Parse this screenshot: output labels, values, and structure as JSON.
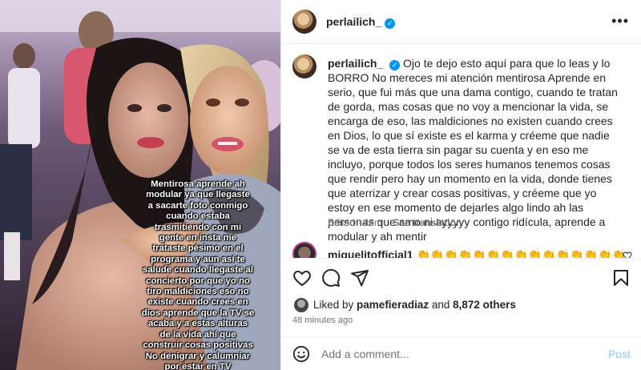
{
  "post": {
    "author": "perlailich_",
    "verified_icon": "verified-check-icon",
    "more_icon": "ellipsis-icon",
    "overlay_text": "Mentirosa aprende ah\nmodular ya que llegaste\na sacarte foto conmigo\ncuando estaba\ntrasmitiendo con mi\ngente en insta me\ntrataste pésimo en el\nprograma  y aun así te\nsalude cuando llegaste al\nconcierto por que yo no\ntiro maldiciones eso no\nexiste cuando crees en\ndios aprende que la TV se\nacaba y a estas alturas\nde la vida ahí que\nconstruir cosas positivas\nNo denigrar y calumniar\npor estar en TV"
  },
  "caption": {
    "username": "perlailich_",
    "text": "Ojo te dejo esto aquí para que lo leas y lo BORRO No mereces mi atención mentirosa Aprende en serio, que fui más que una dama contigo, cuando te tratan de gorda, mas cosas que no voy a mencionar la vida, se encarga de eso, las maldiciones no existen cuando crees en Dios, lo que sí existe es el karma y créeme que nadie se va de esta tierra sin pagar su cuenta y en eso me incluyo, porque todos los seres humanos tenemos cosas que rendir pero hay un momento en la vida, donde tienes que aterrizar y crear cosas positivas, y créeme que yo estoy en ese momento de dejarles algo lindo ah las personas que amo ni ayyyyy contigo ridícula, aprende a modular y ah mentir",
    "edited": "Edited · 46m",
    "see_translation": "See translation"
  },
  "comments": [
    {
      "username": "miguelitofficial1",
      "text": "👏👏👏👏👏👏👏👏👏👏👏👏👏👏👏",
      "like_icon": "heart-outline-icon"
    }
  ],
  "actions": {
    "like_icon": "heart-outline-icon",
    "comment_icon": "speech-bubble-icon",
    "share_icon": "paper-plane-icon",
    "save_icon": "bookmark-icon"
  },
  "likes": {
    "prefix": "Liked by ",
    "user": "pamefieradiaz",
    "middle": " and ",
    "others": "8,872 others"
  },
  "timestamp": "48 minutes ago",
  "add_comment": {
    "placeholder": "Add a comment...",
    "post_label": "Post",
    "emoji_icon": "smiley-icon"
  },
  "colors": {
    "accent": "#0095f6",
    "post_disabled": "#8ec9f5",
    "muted": "#737373",
    "text": "#262626"
  }
}
